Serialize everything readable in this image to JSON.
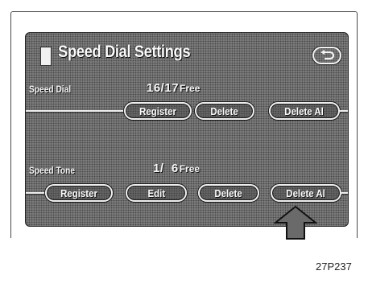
{
  "header": {
    "title": "Speed Dial Settings",
    "back_icon": "return-arrow-icon"
  },
  "speed_dial": {
    "label": "Speed Dial",
    "count": "16/17",
    "free_label": "Free",
    "buttons": {
      "register": "Register",
      "delete": "Delete",
      "delete_all": "Delete Al"
    }
  },
  "speed_tone": {
    "label": "Speed Tone",
    "count": "1/  6",
    "free_label": "Free",
    "buttons": {
      "register": "Register",
      "edit": "Edit",
      "delete": "Delete",
      "delete_all": "Delete Al"
    }
  },
  "pointer_icon": "up-arrow-pointer-icon",
  "caption": "27P237",
  "colors": {
    "screen_bg": "#6d6d6d",
    "button_border": "#f0f0f0",
    "text": "#fafafa"
  }
}
